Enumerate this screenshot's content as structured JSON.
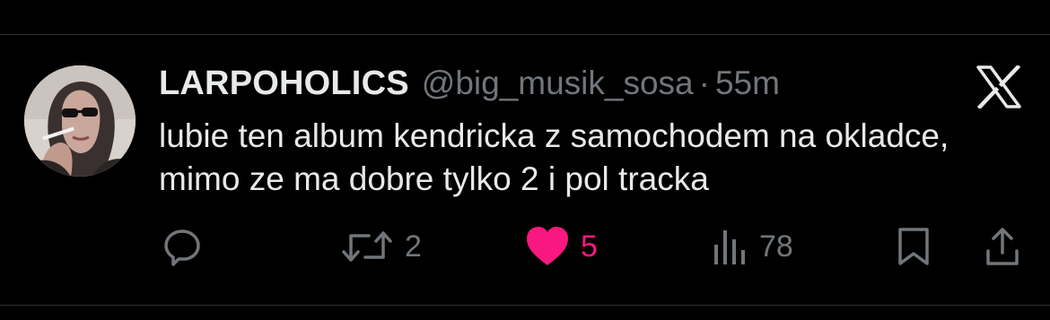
{
  "tweet": {
    "author_name": "LARPOHOLICS",
    "handle": "@big_musik_sosa",
    "separator": "·",
    "time": "55m",
    "text": "lubie ten album kendricka z samochodem na okladce, mimo ze ma dobre tylko 2 i pol tracka"
  },
  "metrics": {
    "replies": "",
    "retweets": "2",
    "likes": "5",
    "views": "78"
  },
  "icons": {
    "logo": "x-logo-icon",
    "reply": "reply-icon",
    "retweet": "retweet-icon",
    "like": "heart-icon",
    "views": "views-icon",
    "bookmark": "bookmark-icon",
    "share": "share-icon"
  },
  "colors": {
    "background": "#000000",
    "primary_text": "#e7e9ea",
    "secondary_text": "#71767b",
    "like_active": "#f91880"
  }
}
